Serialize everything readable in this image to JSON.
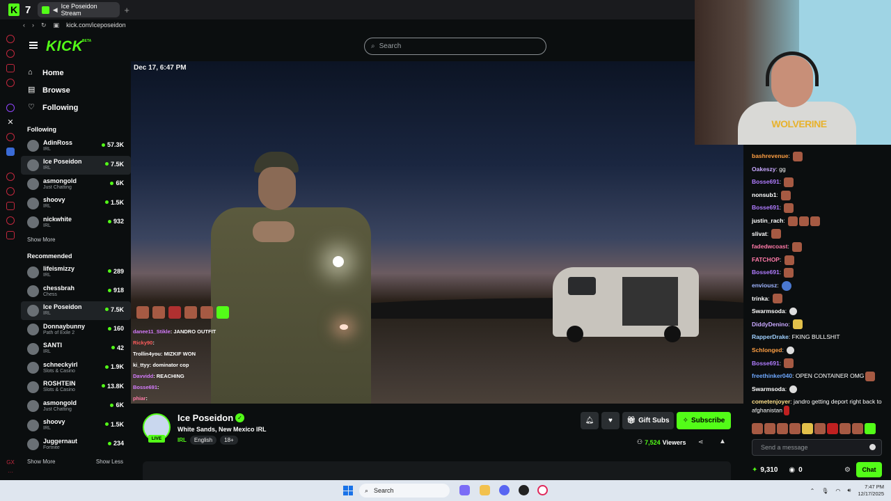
{
  "browser": {
    "tab_count": "7",
    "tab_title": "Ice Poseidon Stream",
    "url": "kick.com/iceposeidon"
  },
  "header": {
    "logo": "KICK",
    "beta": "BETA",
    "search_placeholder": "Search"
  },
  "nav": [
    {
      "label": "Home",
      "icon": "home-icon"
    },
    {
      "label": "Browse",
      "icon": "browse-icon"
    },
    {
      "label": "Following",
      "icon": "heart-icon"
    }
  ],
  "following": {
    "title": "Following",
    "channels": [
      {
        "name": "AdinRoss",
        "category": "IRL",
        "viewers": "57.3K"
      },
      {
        "name": "Ice Poseidon",
        "category": "IRL",
        "viewers": "7.5K"
      },
      {
        "name": "asmongold",
        "category": "Just Chatting",
        "viewers": "6K"
      },
      {
        "name": "shoovy",
        "category": "IRL",
        "viewers": "1.5K"
      },
      {
        "name": "nickwhite",
        "category": "IRL",
        "viewers": "932"
      }
    ],
    "show_more": "Show More"
  },
  "recommended": {
    "title": "Recommended",
    "channels": [
      {
        "name": "lifeismizzy",
        "category": "IRL",
        "viewers": "289"
      },
      {
        "name": "chessbrah",
        "category": "Chess",
        "viewers": "918"
      },
      {
        "name": "Ice Poseidon",
        "category": "IRL",
        "viewers": "7.5K"
      },
      {
        "name": "Donnaybunny",
        "category": "Path of Exile 2",
        "viewers": "160"
      },
      {
        "name": "SANTI",
        "category": "IRL",
        "viewers": "42"
      },
      {
        "name": "schneckyirl",
        "category": "Slots & Casino",
        "viewers": "1.9K"
      },
      {
        "name": "ROSHTEIN",
        "category": "Slots & Casino",
        "viewers": "13.8K"
      },
      {
        "name": "asmongold",
        "category": "Just Chatting",
        "viewers": "6K"
      },
      {
        "name": "shoovy",
        "category": "IRL",
        "viewers": "1.5K"
      },
      {
        "name": "Juggernaut",
        "category": "Fortnite",
        "viewers": "234"
      }
    ],
    "show_more": "Show More",
    "show_less": "Show Less"
  },
  "video": {
    "timestamp": "Dec 17, 6:47 PM",
    "overlay_chat": [
      {
        "user": "danee11_Stikle",
        "text": ": JANDRO",
        "extra": "OUTFIT",
        "color": "#d67cff"
      },
      {
        "user": "Ricky90",
        "text": ":",
        "extra": "",
        "color": "#ff5c5c"
      },
      {
        "user": "Trollin4you",
        "text": ": MIZKIF WON",
        "extra": "",
        "color": "#ffffff"
      },
      {
        "user": "ki_ttyy",
        "text": ": dominator cop",
        "extra": "",
        "color": "#ffffff"
      },
      {
        "user": "Davvidd",
        "text": ": REACHING",
        "extra": "",
        "color": "#d67cff"
      },
      {
        "user": "Bosse691",
        "text": ":",
        "extra": "",
        "color": "#d67cff"
      },
      {
        "user": "phiar",
        "text": ":",
        "extra": "",
        "color": "#ff7aa8"
      }
    ],
    "webcam_shirt": "WOLVERINE"
  },
  "chat": {
    "messages": [
      {
        "user": "bashrevenue",
        "text": "",
        "color": "#ff9f43",
        "emotes": [
          "face"
        ]
      },
      {
        "user": "Oakeszy",
        "text": "gg",
        "color": "#c8a8ff",
        "emotes": []
      },
      {
        "user": "Bosse691",
        "text": "",
        "color": "#b07cff",
        "emotes": [
          "face"
        ]
      },
      {
        "user": "nonsub1",
        "text": "",
        "color": "#ffffff",
        "emotes": [
          "face"
        ]
      },
      {
        "user": "Bosse691",
        "text": "",
        "color": "#b07cff",
        "emotes": [
          "face"
        ]
      },
      {
        "user": "justin_rach",
        "text": "",
        "color": "#ffffff",
        "emotes": [
          "face",
          "face",
          "face"
        ]
      },
      {
        "user": "slivat",
        "text": "",
        "color": "#ffffff",
        "emotes": [
          "face"
        ]
      },
      {
        "user": "fadedwcoast",
        "text": "",
        "color": "#ff7aa8",
        "emotes": [
          "face"
        ]
      },
      {
        "user": "FATCHOP",
        "text": "",
        "color": "#ff7aa8",
        "emotes": [
          "face"
        ]
      },
      {
        "user": "Bosse691",
        "text": "",
        "color": "#b07cff",
        "emotes": [
          "face"
        ]
      },
      {
        "user": "enviousz",
        "text": "",
        "color": "#9fb4ff",
        "emotes": [
          "blue"
        ]
      },
      {
        "user": "trinka",
        "text": "",
        "color": "#ffffff",
        "emotes": [
          "face"
        ]
      },
      {
        "user": "Swarmsoda",
        "text": "",
        "color": "#ffffff",
        "emotes": [
          "skull"
        ]
      },
      {
        "user": "DiddyDenino",
        "text": "",
        "color": "#c8a8ff",
        "emotes": [
          "yellow"
        ]
      },
      {
        "user": "RapperDrake",
        "text": "FKING BULLSHIT",
        "color": "#9fd0ff",
        "emotes": []
      },
      {
        "user": "Schlonged",
        "text": "",
        "color": "#ff9f43",
        "emotes": [
          "skull"
        ]
      },
      {
        "user": "Bosse691",
        "text": "",
        "color": "#b07cff",
        "emotes": [
          "face"
        ]
      },
      {
        "user": "freethinker040",
        "text": "OPEN CONTAINER OMG",
        "color": "#6ea8ff",
        "emotes": [
          "face"
        ]
      },
      {
        "user": "Swarmsoda",
        "text": "",
        "color": "#ffffff",
        "emotes": [
          "skull"
        ]
      },
      {
        "user": "cometenjoyer",
        "text": "jandro getting deport right back to afghanistan",
        "color": "#ffe08a",
        "emotes": [
          "red"
        ]
      }
    ],
    "input_placeholder": "Send a message",
    "points": "9,310",
    "zero": "0",
    "chat_button": "Chat"
  },
  "stream": {
    "streamer": "Ice Poseidon",
    "live_badge": "LIVE",
    "title": "White Sands, New Mexico IRL",
    "category": "IRL",
    "tags": [
      "English",
      "18+"
    ],
    "gift_label": "Gift Subs",
    "subscribe_label": "Subscribe",
    "viewers": "7,524",
    "viewers_label": "Viewers"
  },
  "taskbar": {
    "search": "Search",
    "time": "7:47 PM",
    "date": "12/17/2025"
  },
  "colors": {
    "accent": "#53fc18",
    "background": "#0b0e0f"
  }
}
